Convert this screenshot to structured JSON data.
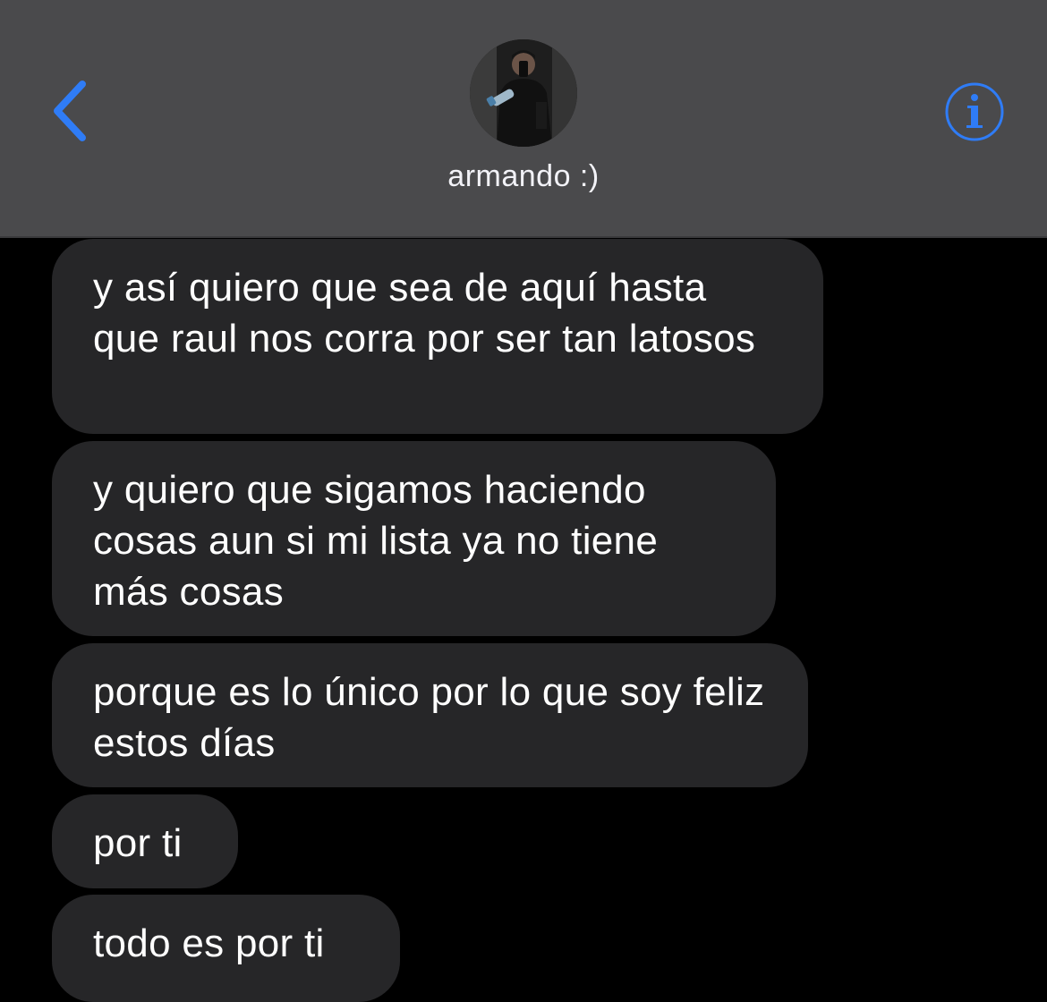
{
  "header": {
    "contact_name": "armando :)",
    "back_icon": "chevron-left-icon",
    "info_icon": "info-icon",
    "accent_color": "#2f7cf6",
    "background_color": "#4a4a4c"
  },
  "messages": [
    {
      "text": "y así quiero que sea de aquí hasta que raul nos corra por ser tan latosos"
    },
    {
      "text": "y quiero que sigamos haciendo cosas aun si mi lista ya no tiene más cosas"
    },
    {
      "text": "porque es lo único por lo que soy feliz estos días"
    },
    {
      "text": "por ti"
    },
    {
      "text": "todo es por ti"
    }
  ],
  "bubble_color": "#262628"
}
